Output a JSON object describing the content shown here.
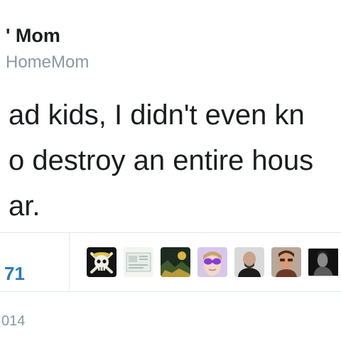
{
  "header": {
    "display_name": "' Mom",
    "handle": "HomeMom"
  },
  "tweet": {
    "lines": [
      "ad kids, I didn't even kn",
      "o destroy an entire hous",
      "ar."
    ]
  },
  "stats": {
    "count": "71"
  },
  "avatars": [
    {
      "icon": "skull-crossbones-icon"
    },
    {
      "icon": "card-image-icon"
    },
    {
      "icon": "landscape-icon"
    },
    {
      "icon": "purple-sunglasses-icon"
    },
    {
      "icon": "bald-man-icon"
    },
    {
      "icon": "man-portrait-icon"
    },
    {
      "icon": "dark-portrait-icon"
    }
  ],
  "timestamp": "014",
  "colors": {
    "text": "#1a1d20",
    "secondary": "#8899a6",
    "link": "#2b7bb9",
    "divider": "#e1e8ed"
  }
}
